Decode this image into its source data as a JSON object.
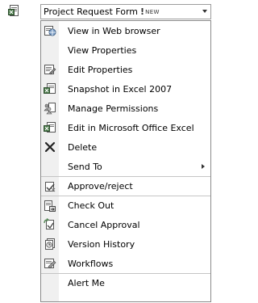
{
  "field": {
    "title": "Project Request Form",
    "new_marker": "!",
    "new_label": "NEW",
    "doc_icon": "document-excel-icon",
    "dropdown_icon": "chevron-down-icon"
  },
  "menu": {
    "items": [
      {
        "label": "View in Web browser",
        "icon": "web-view-icon"
      },
      {
        "label": "View Properties",
        "icon": ""
      },
      {
        "label": "Edit Properties",
        "icon": "edit-properties-icon"
      },
      {
        "label": "Snapshot in Excel 2007",
        "icon": "excel-snapshot-icon"
      },
      {
        "label": "Manage Permissions",
        "icon": "permissions-icon"
      },
      {
        "label": "Edit in Microsoft Office Excel",
        "icon": "excel-edit-icon"
      },
      {
        "label": "Delete",
        "icon": "delete-icon"
      },
      {
        "label": "Send To",
        "icon": "",
        "submenu": true
      },
      {
        "label": "Approve/reject",
        "icon": "approve-icon"
      },
      {
        "label": "Check Out",
        "icon": "checkout-icon"
      },
      {
        "label": "Cancel Approval",
        "icon": "cancel-approval-icon"
      },
      {
        "label": "Version History",
        "icon": "version-history-icon"
      },
      {
        "label": "Workflows",
        "icon": "workflows-icon"
      },
      {
        "label": "Alert Me",
        "icon": ""
      }
    ]
  }
}
